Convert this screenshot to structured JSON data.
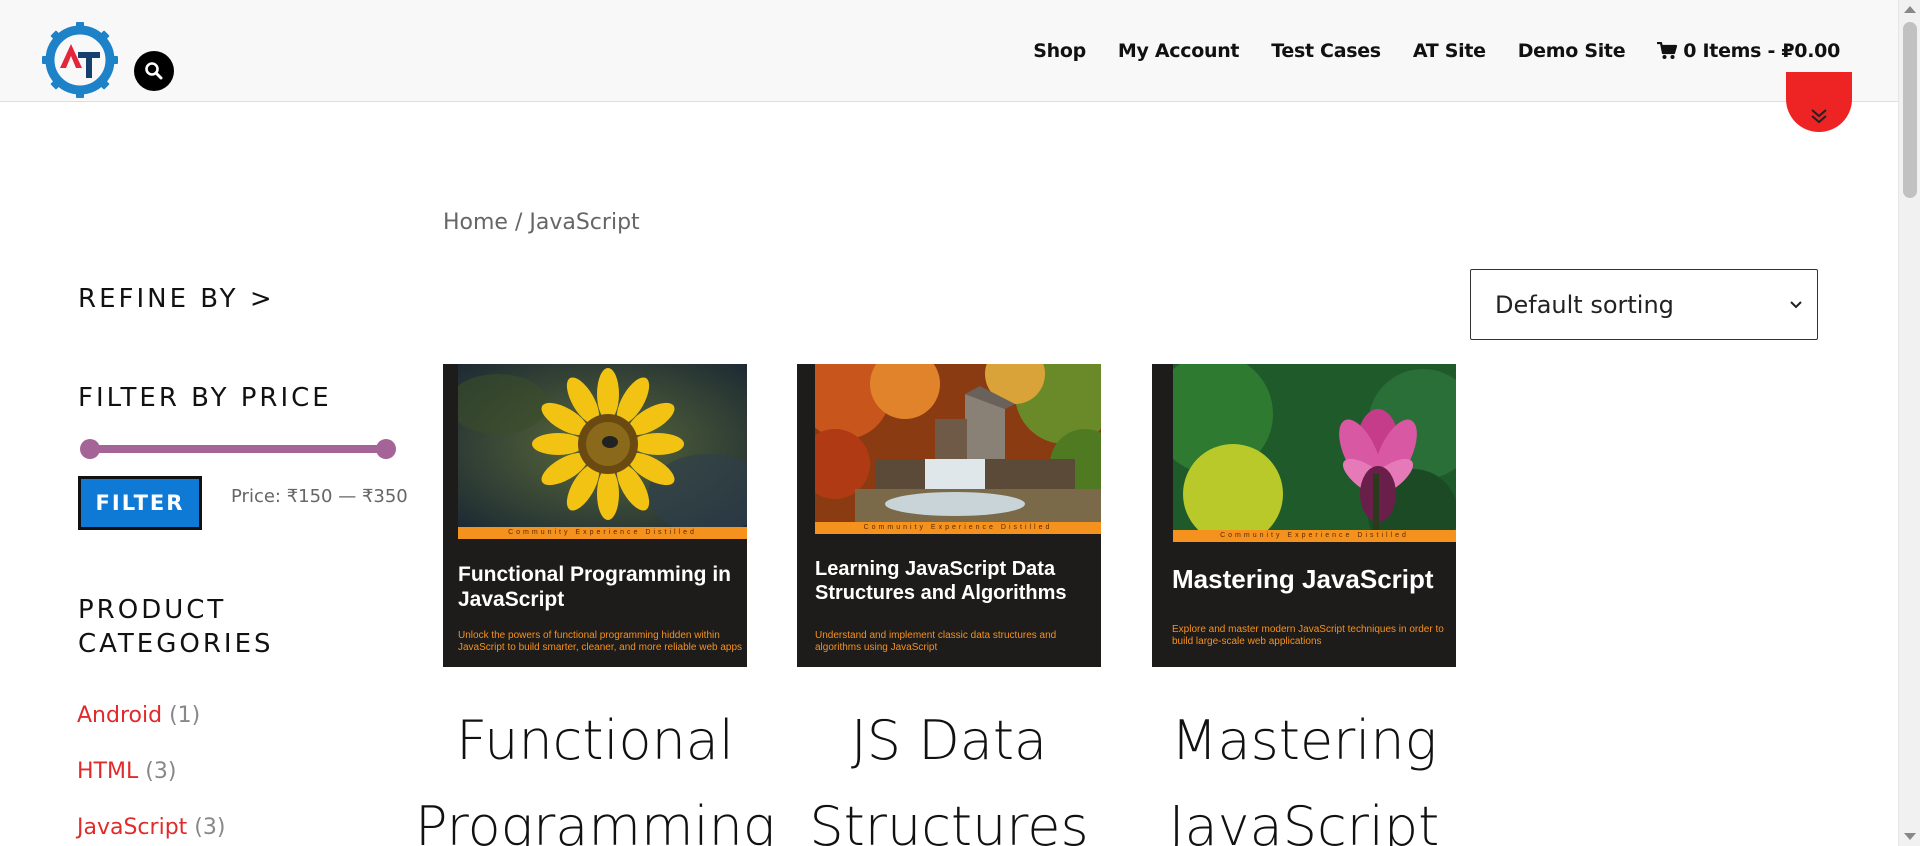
{
  "header": {
    "logo_text": "AT",
    "nav": [
      "Shop",
      "My Account",
      "Test Cases",
      "AT Site",
      "Demo Site"
    ],
    "cart_label": "0 Items - ₽0.00"
  },
  "breadcrumb": {
    "home": "Home",
    "separator": " / ",
    "current": "JavaScript"
  },
  "sorting": {
    "selected": "Default sorting"
  },
  "sidebar": {
    "refine_by": "REFINE BY >",
    "filter_by_price": "FILTER BY PRICE",
    "price_range": {
      "min": 150,
      "max": 350,
      "fill_fraction": 1.0
    },
    "filter_button": "FILTER",
    "price_label": "Price: ₹150 — ₹350",
    "product_categories": "PRODUCT CATEGORIES",
    "categories": [
      {
        "name": "Android",
        "count": "(1)"
      },
      {
        "name": "HTML",
        "count": "(3)"
      },
      {
        "name": "JavaScript",
        "count": "(3)"
      }
    ]
  },
  "products": [
    {
      "cover_band": "Community Experience Distilled",
      "cover_title": "Functional Programming in JavaScript",
      "cover_subtitle": "Unlock the powers of functional programming hidden within JavaScript to build smarter, cleaner, and more reliable web apps",
      "title_line1": "Functional",
      "title_line2": "Programming"
    },
    {
      "cover_band": "Community Experience Distilled",
      "cover_title": "Learning JavaScript Data Structures and Algorithms",
      "cover_subtitle": "Understand and implement classic data structures and algorithms using JavaScript",
      "title_line1": "JS Data",
      "title_line2": "Structures"
    },
    {
      "cover_band": "Community Experience Distilled",
      "cover_title": "Mastering JavaScript",
      "cover_subtitle": "Explore and master modern JavaScript techniques in order to build large-scale web applications",
      "title_line1": "Mastering",
      "title_line2": "JavaScript"
    }
  ],
  "colors": {
    "accent_red": "#ee2324",
    "link_red": "#e12b2b",
    "slider_purple": "#a46497",
    "filter_blue": "#0f7ad6",
    "cover_orange": "#f5921e"
  },
  "icons": [
    "logo-gear-icon",
    "search-icon",
    "cart-icon",
    "double-chevron-down-icon",
    "select-chevron-icon"
  ]
}
